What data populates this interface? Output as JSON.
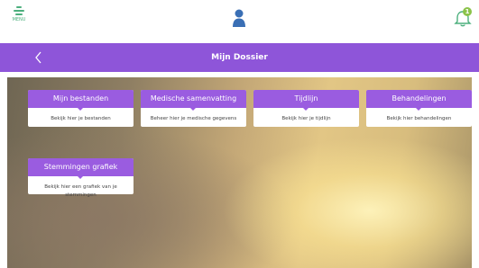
{
  "topbar": {
    "menu_label": "MENU",
    "notification_count": "1",
    "colors": {
      "menu": "#4caf7d",
      "user": "#3a6fb5",
      "badge": "#8bc34a"
    }
  },
  "navbar": {
    "title": "Mijn Dossier",
    "back_icon": "chevron-left-icon",
    "color": "#8e55d9"
  },
  "cards": [
    {
      "title": "Mijn bestanden",
      "description": "Bekijk hier je bestanden"
    },
    {
      "title": "Medische samenvatting",
      "description": "Beheer hier je medische gegevens"
    },
    {
      "title": "Tijdlijn",
      "description": "Bekijk hier je tijdlijn"
    },
    {
      "title": "Behandelingen",
      "description": "Bekijk hier behandelingen"
    },
    {
      "title": "Stemmingen grafiek",
      "description": "Bekijk hier een grafiek van je stemmingen"
    }
  ],
  "card_accent": "#9a5ce0"
}
